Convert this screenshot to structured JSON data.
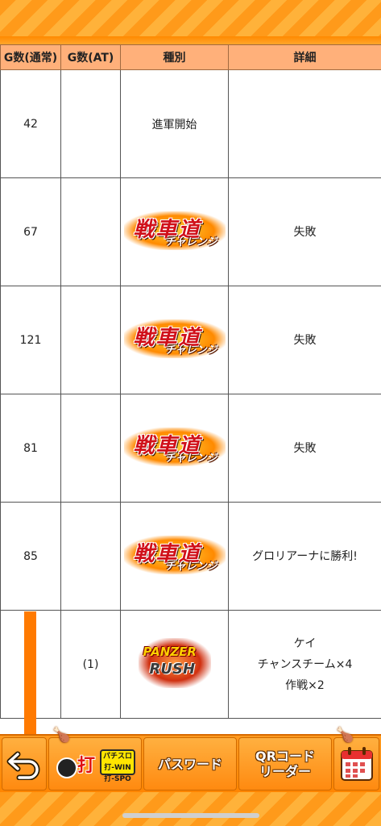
{
  "table": {
    "headers": [
      "G数(通常)",
      "G数(AT)",
      "種別",
      "詳細"
    ],
    "rows": [
      {
        "normal_games": "42",
        "at_games": "",
        "type_text": "進軍開始",
        "type_logo": "",
        "details": [
          "",
          "",
          ""
        ]
      },
      {
        "normal_games": "67",
        "at_games": "",
        "type_text": "",
        "type_logo": "challenge",
        "details": [
          "失敗",
          "",
          ""
        ]
      },
      {
        "normal_games": "121",
        "at_games": "",
        "type_text": "",
        "type_logo": "challenge",
        "details": [
          "失敗",
          "",
          ""
        ]
      },
      {
        "normal_games": "81",
        "at_games": "",
        "type_text": "",
        "type_logo": "challenge",
        "details": [
          "失敗",
          "",
          ""
        ]
      },
      {
        "normal_games": "85",
        "at_games": "",
        "type_text": "",
        "type_logo": "challenge",
        "details": [
          "グロリアーナに勝利!",
          "",
          ""
        ]
      },
      {
        "normal_games": "",
        "at_games": "(1)",
        "type_text": "",
        "type_logo": "panzer",
        "details": [
          "ケイ",
          "チャンスチーム×4",
          "作戦×2"
        ]
      }
    ]
  },
  "logos": {
    "challenge_main": "戦車道",
    "challenge_sub": "チャレンジ",
    "panzer_main": "PANZER",
    "panzer_sub": "RUSH",
    "brand_main": "打",
    "brand_sub": "パチスロ 打-WIN 打-SPO"
  },
  "nav": {
    "password_label": "パスワード",
    "qr_label": "QRコード\nリーダー"
  },
  "colors": {
    "accent": "#ff8a00",
    "header_bg": "#ffb07a"
  }
}
